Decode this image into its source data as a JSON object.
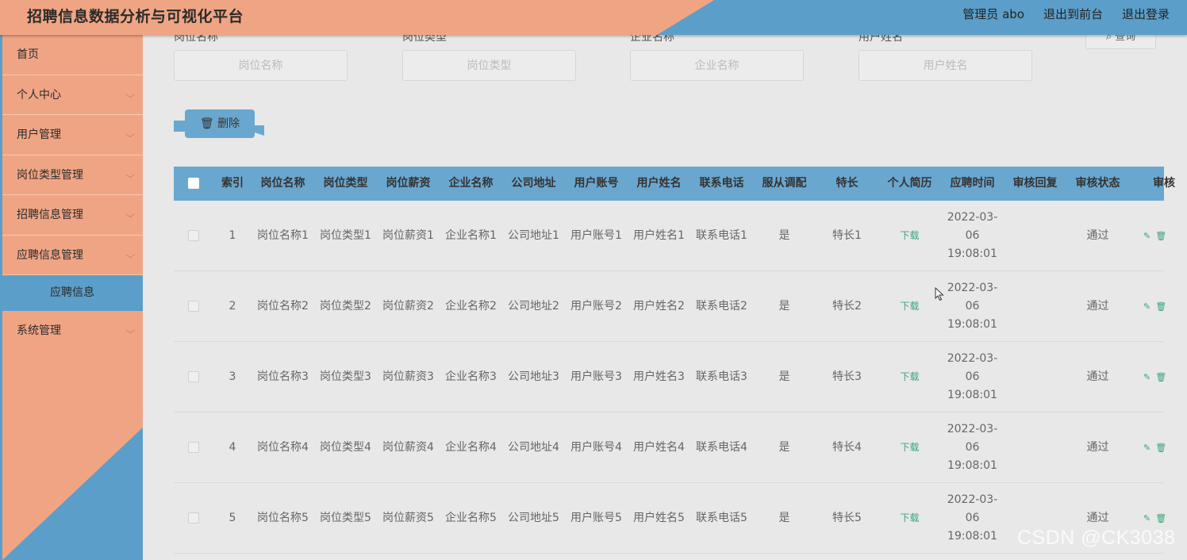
{
  "header": {
    "title": "招聘信息数据分析与可视化平台",
    "admin": "管理员 abo",
    "to_front": "退出到前台",
    "logout": "退出登录"
  },
  "colors": {
    "accent_blue": "#6aa7cf",
    "salmon": "#efa584",
    "link_green": "#3aa67a"
  },
  "sidebar": {
    "items": [
      {
        "label": "首页"
      },
      {
        "label": "个人中心"
      },
      {
        "label": "用户管理"
      },
      {
        "label": "岗位类型管理"
      },
      {
        "label": "招聘信息管理"
      },
      {
        "label": "应聘信息管理"
      }
    ],
    "active_sub": "应聘信息",
    "last_item": "系统管理"
  },
  "search": {
    "labels": [
      "岗位名称",
      "岗位类型",
      "企业名称",
      "用户姓名"
    ],
    "placeholders": [
      "岗位名称",
      "岗位类型",
      "企业名称",
      "用户姓名"
    ],
    "query_label": "查询"
  },
  "toolbar": {
    "delete_label": "删除"
  },
  "table": {
    "headers": [
      "索引",
      "岗位名称",
      "岗位类型",
      "岗位薪资",
      "企业名称",
      "公司地址",
      "用户账号",
      "用户姓名",
      "联系电话",
      "服从调配",
      "特长",
      "个人简历",
      "应聘时间",
      "审核回复",
      "审核状态",
      "审核"
    ],
    "download_label": "下载",
    "rows": [
      {
        "idx": "1",
        "name": "岗位名称1",
        "type": "岗位类型1",
        "salary": "岗位薪资1",
        "company": "企业名称1",
        "address": "公司地址1",
        "account": "用户账号1",
        "user": "用户姓名1",
        "phone": "联系电话1",
        "obey": "是",
        "skill": "特长1",
        "time": "2022-03-06 19:08:01",
        "reply": "",
        "status": "通过"
      },
      {
        "idx": "2",
        "name": "岗位名称2",
        "type": "岗位类型2",
        "salary": "岗位薪资2",
        "company": "企业名称2",
        "address": "公司地址2",
        "account": "用户账号2",
        "user": "用户姓名2",
        "phone": "联系电话2",
        "obey": "是",
        "skill": "特长2",
        "time": "2022-03-06 19:08:01",
        "reply": "",
        "status": "通过"
      },
      {
        "idx": "3",
        "name": "岗位名称3",
        "type": "岗位类型3",
        "salary": "岗位薪资3",
        "company": "企业名称3",
        "address": "公司地址3",
        "account": "用户账号3",
        "user": "用户姓名3",
        "phone": "联系电话3",
        "obey": "是",
        "skill": "特长3",
        "time": "2022-03-06 19:08:01",
        "reply": "",
        "status": "通过"
      },
      {
        "idx": "4",
        "name": "岗位名称4",
        "type": "岗位类型4",
        "salary": "岗位薪资4",
        "company": "企业名称4",
        "address": "公司地址4",
        "account": "用户账号4",
        "user": "用户姓名4",
        "phone": "联系电话4",
        "obey": "是",
        "skill": "特长4",
        "time": "2022-03-06 19:08:01",
        "reply": "",
        "status": "通过"
      },
      {
        "idx": "5",
        "name": "岗位名称5",
        "type": "岗位类型5",
        "salary": "岗位薪资5",
        "company": "企业名称5",
        "address": "公司地址5",
        "account": "用户账号5",
        "user": "用户姓名5",
        "phone": "联系电话5",
        "obey": "是",
        "skill": "特长5",
        "time": "2022-03-06 19:08:01",
        "reply": "",
        "status": "通过"
      }
    ]
  },
  "watermark": "CSDN @CK3038"
}
